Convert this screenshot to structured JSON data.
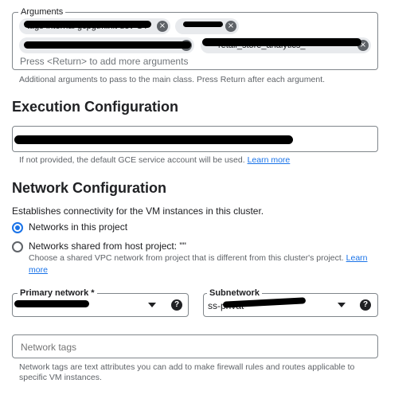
{
  "arguments": {
    "label": "Arguments",
    "chips": [
      {
        "text": "tags internal gcpgtminit dev GT"
      },
      {
        "text": ""
      },
      {
        "text": ""
      },
      {
        "text": "retail_store_analytics_"
      }
    ],
    "hint": "Press <Return> to add more arguments",
    "remove_symbol": "×",
    "help": "Additional arguments to pass to the main class. Press Return after each argument."
  },
  "execution": {
    "title": "Execution Configuration",
    "help": "If not provided, the default GCE service account will be used.",
    "learn_more": "Learn more"
  },
  "network": {
    "title": "Network Configuration",
    "description": "Establishes connectivity for the VM instances in this cluster.",
    "options": [
      {
        "label": "Networks in this project",
        "selected": true
      },
      {
        "label": "Networks shared from host project: \"\"",
        "selected": false,
        "sublabel": "Choose a shared VPC network from project that is different from this cluster's project.",
        "learn_more": "Learn more"
      }
    ],
    "primary_network": {
      "label": "Primary network *",
      "help_symbol": "?"
    },
    "subnetwork": {
      "label": "Subnetwork",
      "value": "ss-privat",
      "help_symbol": "?"
    },
    "tags": {
      "placeholder": "Network tags",
      "help": "Network tags are text attributes you can add to make firewall rules and routes applicable to specific VM instances."
    }
  },
  "colors": {
    "accent": "#1a73e8",
    "border": "#80868b",
    "chip": "#e8eaed"
  }
}
